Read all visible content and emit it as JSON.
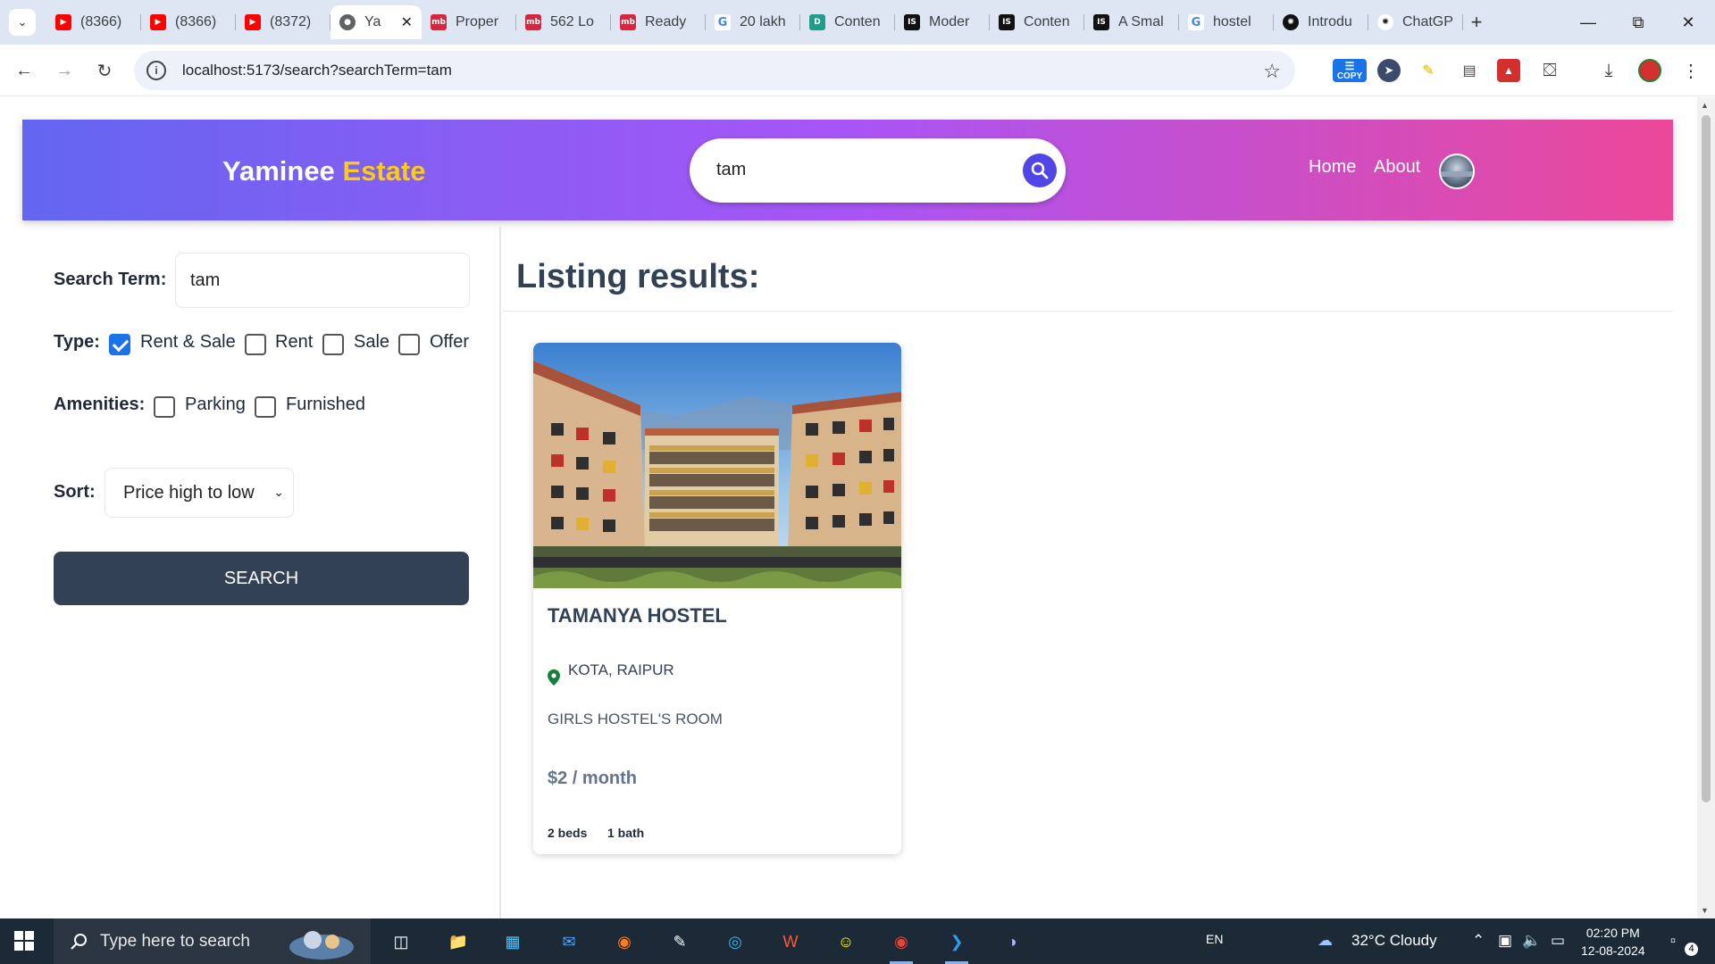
{
  "browser": {
    "tabs": [
      {
        "title": "(8366)",
        "favicon": "youtube-icon",
        "color": "#ff0000"
      },
      {
        "title": "(8366)",
        "favicon": "youtube-icon",
        "color": "#ff0000"
      },
      {
        "title": "(8372)",
        "favicon": "youtube-icon",
        "color": "#ff0000"
      },
      {
        "title": "Ya",
        "favicon": "globe-icon",
        "active": true
      },
      {
        "title": "Proper",
        "favicon": "mb-icon",
        "color": "#d7263d"
      },
      {
        "title": "562 Lo",
        "favicon": "mb-icon",
        "color": "#d7263d"
      },
      {
        "title": "Ready",
        "favicon": "mb-icon",
        "color": "#d7263d"
      },
      {
        "title": "20 lakh",
        "favicon": "google-icon",
        "color": "#4285f4"
      },
      {
        "title": "Conten",
        "favicon": "doc-icon",
        "color": "#1f9d8b"
      },
      {
        "title": "Moder",
        "favicon": "is-icon",
        "color": "#111111"
      },
      {
        "title": "Conten",
        "favicon": "is-icon",
        "color": "#111111"
      },
      {
        "title": "A Smal",
        "favicon": "is-icon",
        "color": "#111111"
      },
      {
        "title": "hostel",
        "favicon": "google-icon",
        "color": "#4285f4"
      },
      {
        "title": "Introdu",
        "favicon": "openai-icon",
        "color": "#111111"
      },
      {
        "title": "ChatGP",
        "favicon": "openai-icon",
        "color": "#111111"
      }
    ],
    "url": "localhost:5173/search?searchTerm=tam",
    "copy_ext_label": "COPY"
  },
  "header": {
    "logo_part1": "Yaminee",
    "logo_part2": "Estate",
    "search_value": "tam",
    "nav": [
      "Home",
      "About"
    ],
    "colors": {
      "gradient_start": "#6366f1",
      "gradient_mid": "#a855f7",
      "gradient_end": "#ec4899",
      "logo_accent": "#facc15"
    }
  },
  "filters": {
    "search_term_label": "Search Term:",
    "search_term_value": "tam",
    "type_label": "Type:",
    "type_options": [
      {
        "label": "Rent & Sale",
        "checked": true
      },
      {
        "label": "Rent",
        "checked": false
      },
      {
        "label": "Sale",
        "checked": false
      },
      {
        "label": "Offer",
        "checked": false
      }
    ],
    "amenities_label": "Amenities:",
    "amenity_options": [
      {
        "label": "Parking",
        "checked": false
      },
      {
        "label": "Furnished",
        "checked": false
      }
    ],
    "sort_label": "Sort:",
    "sort_value": "Price high to low",
    "search_button": "SEARCH"
  },
  "results": {
    "title": "Listing results:",
    "listings": [
      {
        "name": "TAMANYA HOSTEL",
        "location": "KOTA, RAIPUR",
        "description": "GIRLS HOSTEL'S ROOM",
        "price": "$2 / month",
        "beds": "2 beds",
        "baths": "1 bath"
      }
    ]
  },
  "taskbar": {
    "search_placeholder": "Type here to search",
    "language": "EN",
    "weather": "32°C Cloudy",
    "time": "02:20 PM",
    "date": "12-08-2024",
    "notification_count": "4"
  }
}
